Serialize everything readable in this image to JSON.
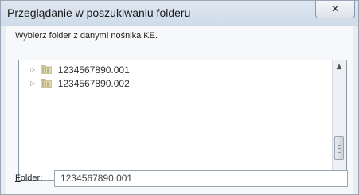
{
  "window": {
    "title": "Przeglądanie w poszukiwaniu folderu",
    "close_glyph": "✕"
  },
  "instruction": "Wybierz folder z danymi nośnika KE.",
  "tree": {
    "items": [
      {
        "label": "1234567890.001",
        "icon": "folder-icon",
        "expander": "▷"
      },
      {
        "label": "1234567890.002",
        "icon": "folder-icon",
        "expander": "▷"
      }
    ],
    "scroll_up_glyph": "▲",
    "scroll_down_glyph": "▼"
  },
  "folder_field": {
    "label_accel": "F",
    "label_rest": "older:",
    "value": "1234567890.001"
  }
}
